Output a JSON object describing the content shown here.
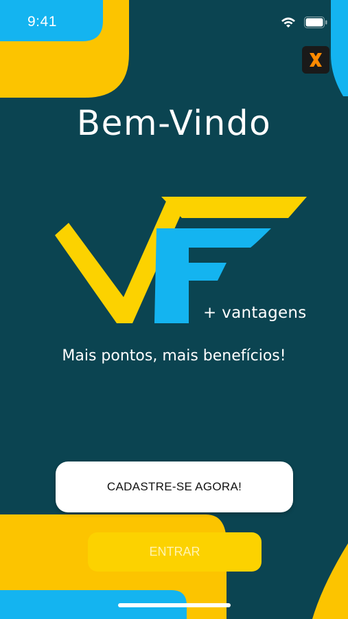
{
  "status_bar": {
    "time": "9:41"
  },
  "overlay_badge": {
    "glyph": "X",
    "icon": "x-app-icon"
  },
  "welcome": {
    "title": "Bem-Vindo"
  },
  "logo": {
    "subtext": "+ vantagens"
  },
  "tagline": "Mais pontos, mais benefícios!",
  "buttons": {
    "signup_label": "CADASTRE-SE AGORA!",
    "enter_label": "ENTRAR"
  },
  "colors": {
    "background": "#0b4451",
    "brand_yellow": "#fcd200",
    "brand_blue": "#14b4f0",
    "accent_orange": "#ff8a00"
  }
}
